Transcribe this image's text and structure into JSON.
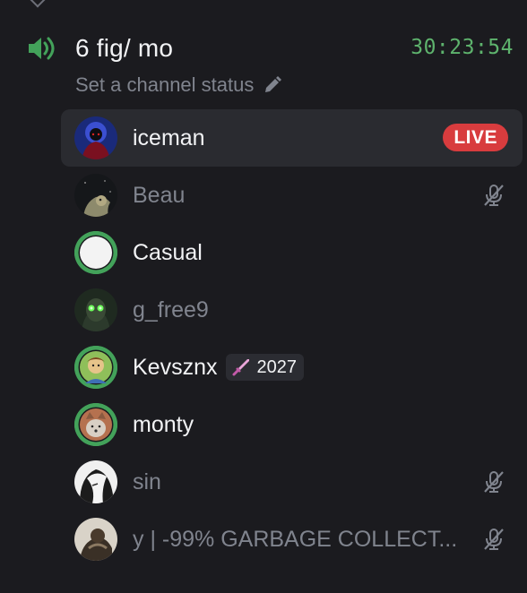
{
  "channel": {
    "name": "6 fig/ mo",
    "timer": "30:23:54",
    "status_placeholder": "Set a channel status"
  },
  "colors": {
    "background": "#1b1b1f",
    "speaking_ring": "#43a25a",
    "timer": "#5eb36d",
    "live": "#d83c3e",
    "muted_text": "#80848e"
  },
  "members": [
    {
      "name": "iceman",
      "live": true,
      "live_label": "LIVE",
      "muted": false,
      "speaking": false
    },
    {
      "name": "Beau",
      "muted": true,
      "speaking": false,
      "icon": "mic-off-icon"
    },
    {
      "name": "Casual",
      "muted": false,
      "speaking": true
    },
    {
      "name": "g_free9",
      "muted": false,
      "speaking": false,
      "dimmed": true
    },
    {
      "name": "Kevsznx",
      "muted": false,
      "speaking": true,
      "badge": {
        "icon": "sword-icon",
        "label": "2027"
      }
    },
    {
      "name": "monty",
      "muted": false,
      "speaking": true
    },
    {
      "name": "sin",
      "muted": true,
      "speaking": false,
      "icon": "mic-off-icon"
    },
    {
      "name": "y | -99% GARBAGE COLLECT...",
      "muted": true,
      "speaking": false,
      "icon": "mic-off-icon"
    }
  ]
}
